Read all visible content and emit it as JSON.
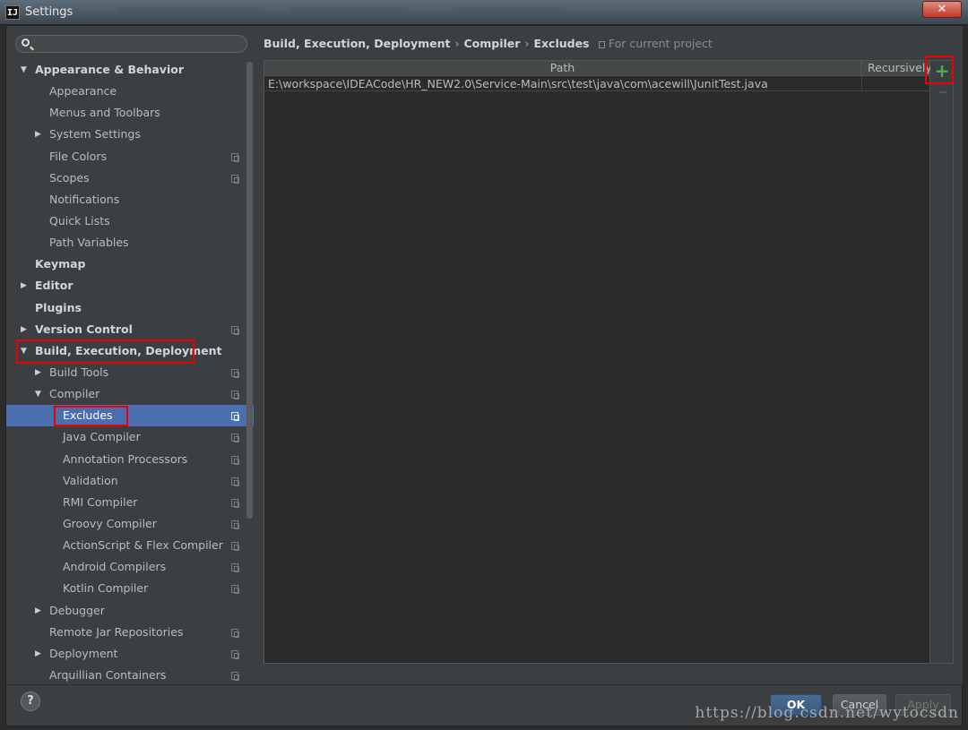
{
  "window": {
    "title": "Settings",
    "logo": "IJ",
    "close": "✕"
  },
  "sidebar": {
    "search": {
      "placeholder": "",
      "value": ""
    },
    "items": [
      {
        "label": "Appearance & Behavior",
        "level": 0,
        "arrow": "▼",
        "bold": true,
        "copy": false
      },
      {
        "label": "Appearance",
        "level": 1,
        "arrow": "",
        "bold": false,
        "copy": false
      },
      {
        "label": "Menus and Toolbars",
        "level": 1,
        "arrow": "",
        "bold": false,
        "copy": false
      },
      {
        "label": "System Settings",
        "level": 1,
        "arrow": "▶",
        "bold": false,
        "copy": false
      },
      {
        "label": "File Colors",
        "level": 1,
        "arrow": "",
        "bold": false,
        "copy": true
      },
      {
        "label": "Scopes",
        "level": 1,
        "arrow": "",
        "bold": false,
        "copy": true
      },
      {
        "label": "Notifications",
        "level": 1,
        "arrow": "",
        "bold": false,
        "copy": false
      },
      {
        "label": "Quick Lists",
        "level": 1,
        "arrow": "",
        "bold": false,
        "copy": false
      },
      {
        "label": "Path Variables",
        "level": 1,
        "arrow": "",
        "bold": false,
        "copy": false
      },
      {
        "label": "Keymap",
        "level": 0,
        "arrow": "",
        "bold": true,
        "copy": false
      },
      {
        "label": "Editor",
        "level": 0,
        "arrow": "▶",
        "bold": true,
        "copy": false
      },
      {
        "label": "Plugins",
        "level": 0,
        "arrow": "",
        "bold": true,
        "copy": false
      },
      {
        "label": "Version Control",
        "level": 0,
        "arrow": "▶",
        "bold": true,
        "copy": true
      },
      {
        "label": "Build, Execution, Deployment",
        "level": 0,
        "arrow": "▼",
        "bold": true,
        "copy": false
      },
      {
        "label": "Build Tools",
        "level": 1,
        "arrow": "▶",
        "bold": false,
        "copy": true
      },
      {
        "label": "Compiler",
        "level": 1,
        "arrow": "▼",
        "bold": false,
        "copy": true
      },
      {
        "label": "Excludes",
        "level": 2,
        "arrow": "",
        "bold": false,
        "copy": true,
        "selected": true
      },
      {
        "label": "Java Compiler",
        "level": 2,
        "arrow": "",
        "bold": false,
        "copy": true
      },
      {
        "label": "Annotation Processors",
        "level": 2,
        "arrow": "",
        "bold": false,
        "copy": true
      },
      {
        "label": "Validation",
        "level": 2,
        "arrow": "",
        "bold": false,
        "copy": true
      },
      {
        "label": "RMI Compiler",
        "level": 2,
        "arrow": "",
        "bold": false,
        "copy": true
      },
      {
        "label": "Groovy Compiler",
        "level": 2,
        "arrow": "",
        "bold": false,
        "copy": true
      },
      {
        "label": "ActionScript & Flex Compiler",
        "level": 2,
        "arrow": "",
        "bold": false,
        "copy": true
      },
      {
        "label": "Android Compilers",
        "level": 2,
        "arrow": "",
        "bold": false,
        "copy": true
      },
      {
        "label": "Kotlin Compiler",
        "level": 2,
        "arrow": "",
        "bold": false,
        "copy": true
      },
      {
        "label": "Debugger",
        "level": 1,
        "arrow": "▶",
        "bold": false,
        "copy": false
      },
      {
        "label": "Remote Jar Repositories",
        "level": 1,
        "arrow": "",
        "bold": false,
        "copy": true
      },
      {
        "label": "Deployment",
        "level": 1,
        "arrow": "▶",
        "bold": false,
        "copy": true
      },
      {
        "label": "Arquillian Containers",
        "level": 1,
        "arrow": "",
        "bold": false,
        "copy": true
      }
    ]
  },
  "breadcrumb": {
    "parts": [
      "Build, Execution, Deployment",
      "Compiler",
      "Excludes"
    ],
    "separator": "›",
    "scope": "For current project"
  },
  "excludes_table": {
    "columns": [
      "Path",
      "Recursively"
    ],
    "rows": [
      {
        "path": "E:\\workspace\\IDEACode\\HR_NEW2.0\\Service-Main\\src\\test\\java\\com\\acewill\\JunitTest.java",
        "recursively": ""
      }
    ],
    "add_icon": "+",
    "remove_icon": "remove-icon"
  },
  "footer": {
    "help": "?",
    "ok": "OK",
    "cancel": "Cancel",
    "apply": "Apply"
  },
  "watermark": "https://blog.csdn.net/wytocsdn",
  "colors": {
    "selection": "#4b6eaf",
    "annotation": "#e00000",
    "add_green": "#4cae4c",
    "panel": "#3c3f41",
    "table_bg": "#2b2b2b"
  }
}
